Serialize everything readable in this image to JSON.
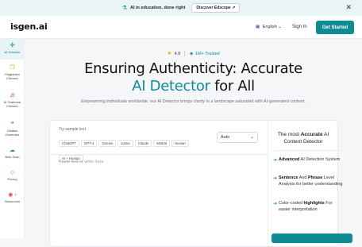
{
  "banner": {
    "text": "AI in education, done right",
    "button": "Discover Edscope",
    "button_icon": "↗",
    "close": "✕"
  },
  "header": {
    "logo": "isgen.ai",
    "language": "English",
    "language_chevron": "⌄",
    "sign_in": "Sign In",
    "get_started": "Get Started"
  },
  "sidebar": {
    "items": [
      {
        "label": "AI Detector",
        "icon": "ai-detector-icon",
        "glyph": "✣",
        "active": true
      },
      {
        "label": "Plagiarism Checker",
        "icon": "plagiarism-icon",
        "glyph": "❐"
      },
      {
        "label": "AI Grammar Checker",
        "icon": "grammar-icon",
        "glyph": "Ꭿ"
      },
      {
        "label": "Citation Generator",
        "icon": "citation-icon",
        "glyph": "❝"
      },
      {
        "label": "Bulk Scan",
        "icon": "bulk-scan-icon",
        "glyph": "☁"
      },
      {
        "label": "Pricing",
        "icon": "pricing-icon",
        "glyph": "◇"
      },
      {
        "label": "Resources",
        "icon": "resources-icon",
        "glyph": "◉ ›"
      }
    ]
  },
  "hero": {
    "rating": "4.9",
    "trusted": "1M+ Trusted",
    "title_line1": "Ensuring Authenticity: Accurate",
    "title_highlight": "AI Detector",
    "title_rest": " for All",
    "subtitle": "Empowering individuals worldwide, our AI Detector brings clarity in a landscape saturated with AI-generated content."
  },
  "input_card": {
    "try_label": "Try sample text",
    "samples": [
      "ChatGPT",
      "GPT-4",
      "Gemini",
      "Llama",
      "Claude",
      "Mistral",
      "Human",
      "AI + Human"
    ],
    "model_select": "Auto",
    "placeholder": "Paste text or write here"
  },
  "info_panel": {
    "title_pre": "The most ",
    "title_bold": "Accurate",
    "title_post": " AI",
    "title_line2": "Content Detector",
    "features": [
      {
        "bold": "Advanced",
        "rest": " AI Detection System"
      },
      {
        "bold": "Sentence",
        "rest": " And ",
        "bold2": "Phrase",
        "rest2": " Level Analysis for better understanding"
      },
      {
        "pre": "Color-coded ",
        "bold": "highlights",
        "rest": " For easier interpretation"
      }
    ]
  },
  "colors": {
    "accent": "#0e8b93",
    "star": "#f5b31b",
    "banner_bg": "#e9f4f4"
  }
}
